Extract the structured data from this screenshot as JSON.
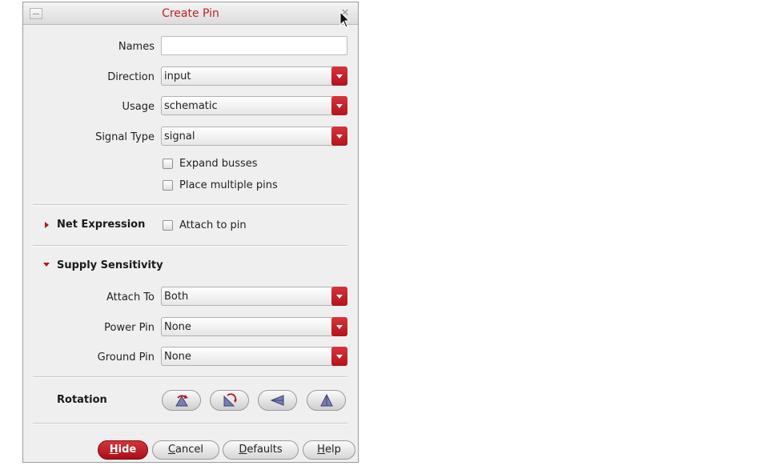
{
  "window": {
    "title": "Create Pin"
  },
  "fields": {
    "names": {
      "label": "Names",
      "value": ""
    },
    "direction": {
      "label": "Direction",
      "value": "input"
    },
    "usage": {
      "label": "Usage",
      "value": "schematic"
    },
    "signal_type": {
      "label": "Signal Type",
      "value": "signal"
    }
  },
  "checkboxes": {
    "expand_busses": {
      "label": "Expand busses",
      "checked": false
    },
    "place_multiple_pins": {
      "label": "Place multiple pins",
      "checked": false
    },
    "attach_to_pin": {
      "label": "Attach to pin",
      "checked": false
    }
  },
  "net_expression": {
    "title": "Net Expression",
    "expanded": false
  },
  "supply_sensitivity": {
    "title": "Supply Sensitivity",
    "expanded": true,
    "attach_to": {
      "label": "Attach To",
      "value": "Both"
    },
    "power_pin": {
      "label": "Power Pin",
      "value": "None"
    },
    "ground_pin": {
      "label": "Ground Pin",
      "value": "None"
    }
  },
  "rotation": {
    "label": "Rotation",
    "buttons": [
      "rotate-icon",
      "sideways-icon",
      "upside-down-icon",
      "mirror-icon"
    ]
  },
  "buttons": {
    "hide": {
      "prefix": "",
      "mnemonic": "H",
      "rest": "ide"
    },
    "cancel": {
      "prefix": "",
      "mnemonic": "C",
      "rest": "ancel"
    },
    "defaults": {
      "prefix": "",
      "mnemonic": "D",
      "rest": "efaults"
    },
    "help": {
      "prefix": "",
      "mnemonic": "H",
      "rest": "elp"
    }
  },
  "colors": {
    "accent": "#b3141c",
    "title": "#c0202a",
    "panel": "#efefef"
  }
}
